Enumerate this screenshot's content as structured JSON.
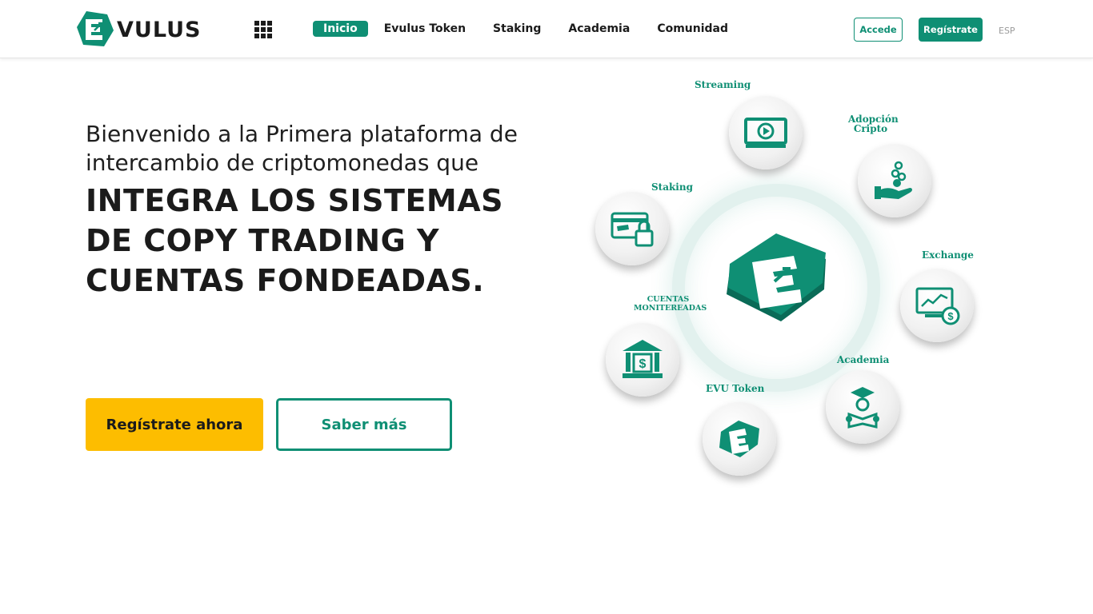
{
  "header": {
    "logo_text": "VULUS",
    "nav": [
      "Inicio",
      "Evulus Token",
      "Staking",
      "Academia",
      "Comunidad"
    ],
    "accede_label": "Accede",
    "registrate_label": "Regístrate",
    "lang_label": "ESP"
  },
  "hero": {
    "subtitle": "Bienvenido a la Primera plataforma de intercambio de criptomonedas que",
    "title_lines": [
      "INTEGRA LOS SISTEMAS",
      "DE COPY TRADING Y",
      "CUENTAS FONDEADAS."
    ],
    "cta_primary": "Regístrate ahora",
    "cta_secondary": "Saber más"
  },
  "illustration": {
    "nodes": [
      {
        "label": "Streaming",
        "icon": "play-video-icon"
      },
      {
        "label": "Adopción Cripto",
        "icon": "hand-coins-icon"
      },
      {
        "label": "Exchange",
        "icon": "chart-monitor-icon"
      },
      {
        "label": "Academia",
        "icon": "graduate-reading-icon"
      },
      {
        "label": "EVU Token",
        "icon": "evu-token-icon"
      },
      {
        "label": "CUENTAS MONITEREADAS",
        "icon": "bank-dollar-icon"
      },
      {
        "label": "Staking",
        "icon": "card-lock-icon"
      }
    ]
  },
  "colors": {
    "brand": "#0f8f74",
    "accent": "#fdbd00",
    "text": "#1b1b1b"
  }
}
